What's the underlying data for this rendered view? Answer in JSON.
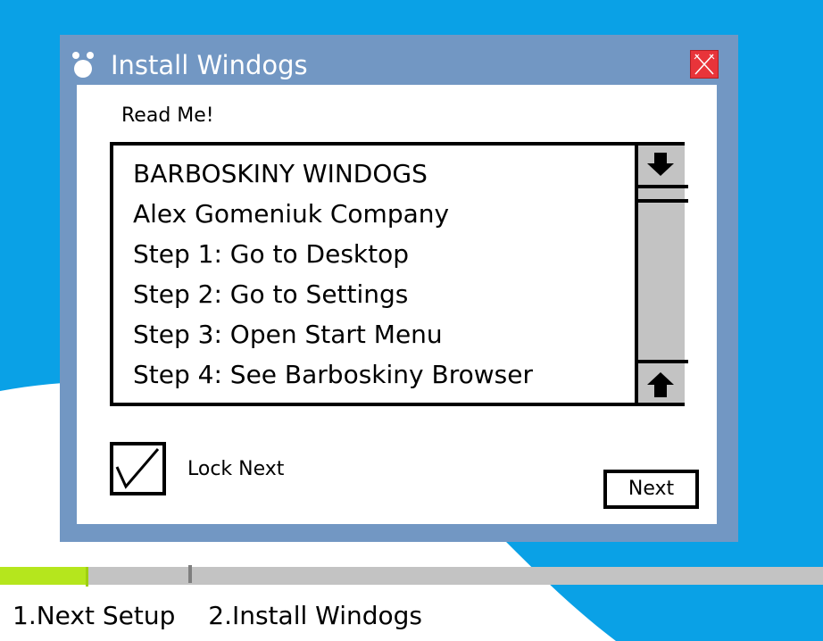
{
  "window": {
    "title": "Install Windogs"
  },
  "readme": {
    "heading": "Read Me!",
    "lines": [
      "BARBOSKINY WINDOGS",
      "Alex Gomeniuk Company",
      "Step 1: Go to Desktop",
      "Step 2: Go to Settings",
      "Step 3: Open Start Menu",
      "Step 4: See Barboskiny Browser"
    ]
  },
  "options": {
    "lock_next_label": "Lock Next",
    "lock_next_checked": true
  },
  "buttons": {
    "next_label": "Next"
  },
  "progress": {
    "fraction": 0.107,
    "steps": [
      "1.Next Setup",
      "2.Install Windogs"
    ]
  },
  "colors": {
    "desktop": "#0aa1e6",
    "window_frame": "#7297c3",
    "close_button": "#e8343a",
    "progress_fill": "#b5e61d",
    "progress_track": "#c3c3c3",
    "scrollbar": "#c3c3c3"
  },
  "icons": {
    "app": "paw-icon",
    "close": "close-icon",
    "scroll_top": "arrow-down-icon",
    "scroll_bottom": "arrow-up-icon",
    "checkbox": "checkmark-icon"
  }
}
